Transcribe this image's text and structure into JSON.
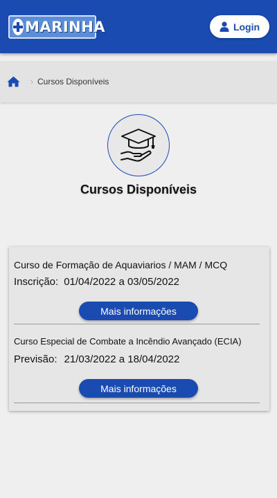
{
  "header": {
    "logo_text": "MARINHA",
    "login_label": "Login"
  },
  "breadcrumb": {
    "separator": "›",
    "current": "Cursos Disponíveis"
  },
  "page": {
    "title": "Cursos Disponíveis"
  },
  "courses": [
    {
      "title": "Curso de Formação de Aquaviarios / MAM / MCQ",
      "date_label": "Inscrição:",
      "date_value": "01/04/2022 a 03/05/2022",
      "button_label": "Mais informações"
    },
    {
      "title": "Curso Especial de Combate a Incêndio Avançado (ECIA)",
      "date_label": "Previsão:",
      "date_value": "21/03/2022 a 18/04/2022",
      "button_label": "Mais informações"
    }
  ],
  "colors": {
    "primary": "#1a4bb0",
    "logo_bg": "#5b8ed8",
    "page_bg": "#efefef"
  },
  "icons": {
    "logo": "plus-icon",
    "login": "user-icon",
    "home": "home-icon",
    "hero": "graduation-cap-hand-icon"
  }
}
